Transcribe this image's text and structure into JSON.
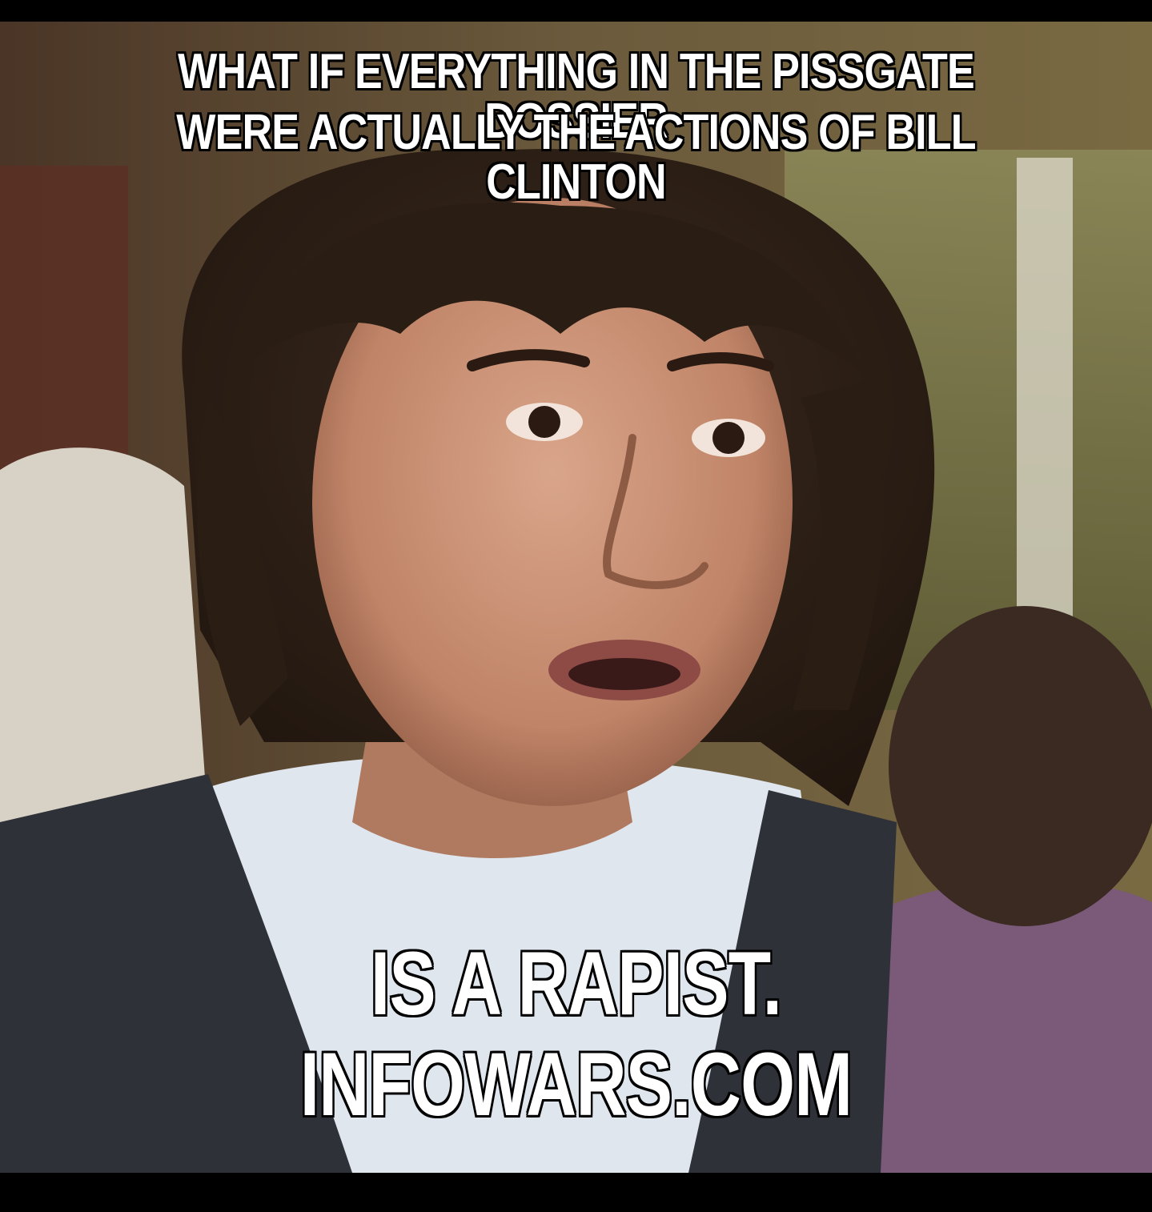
{
  "meme": {
    "top_text": [
      "WHAT IF EVERYTHING IN THE PISSGATE DOSSIER",
      "WERE ACTUALLY THE ACTIONS OF BILL CLINTON"
    ],
    "bottom_text": [
      "IS A RAPIST.",
      "INFOWARS.COM"
    ],
    "colors": {
      "caption_fill": "#ffffff",
      "caption_outline": "#000000",
      "letterbox": "#000000"
    }
  }
}
